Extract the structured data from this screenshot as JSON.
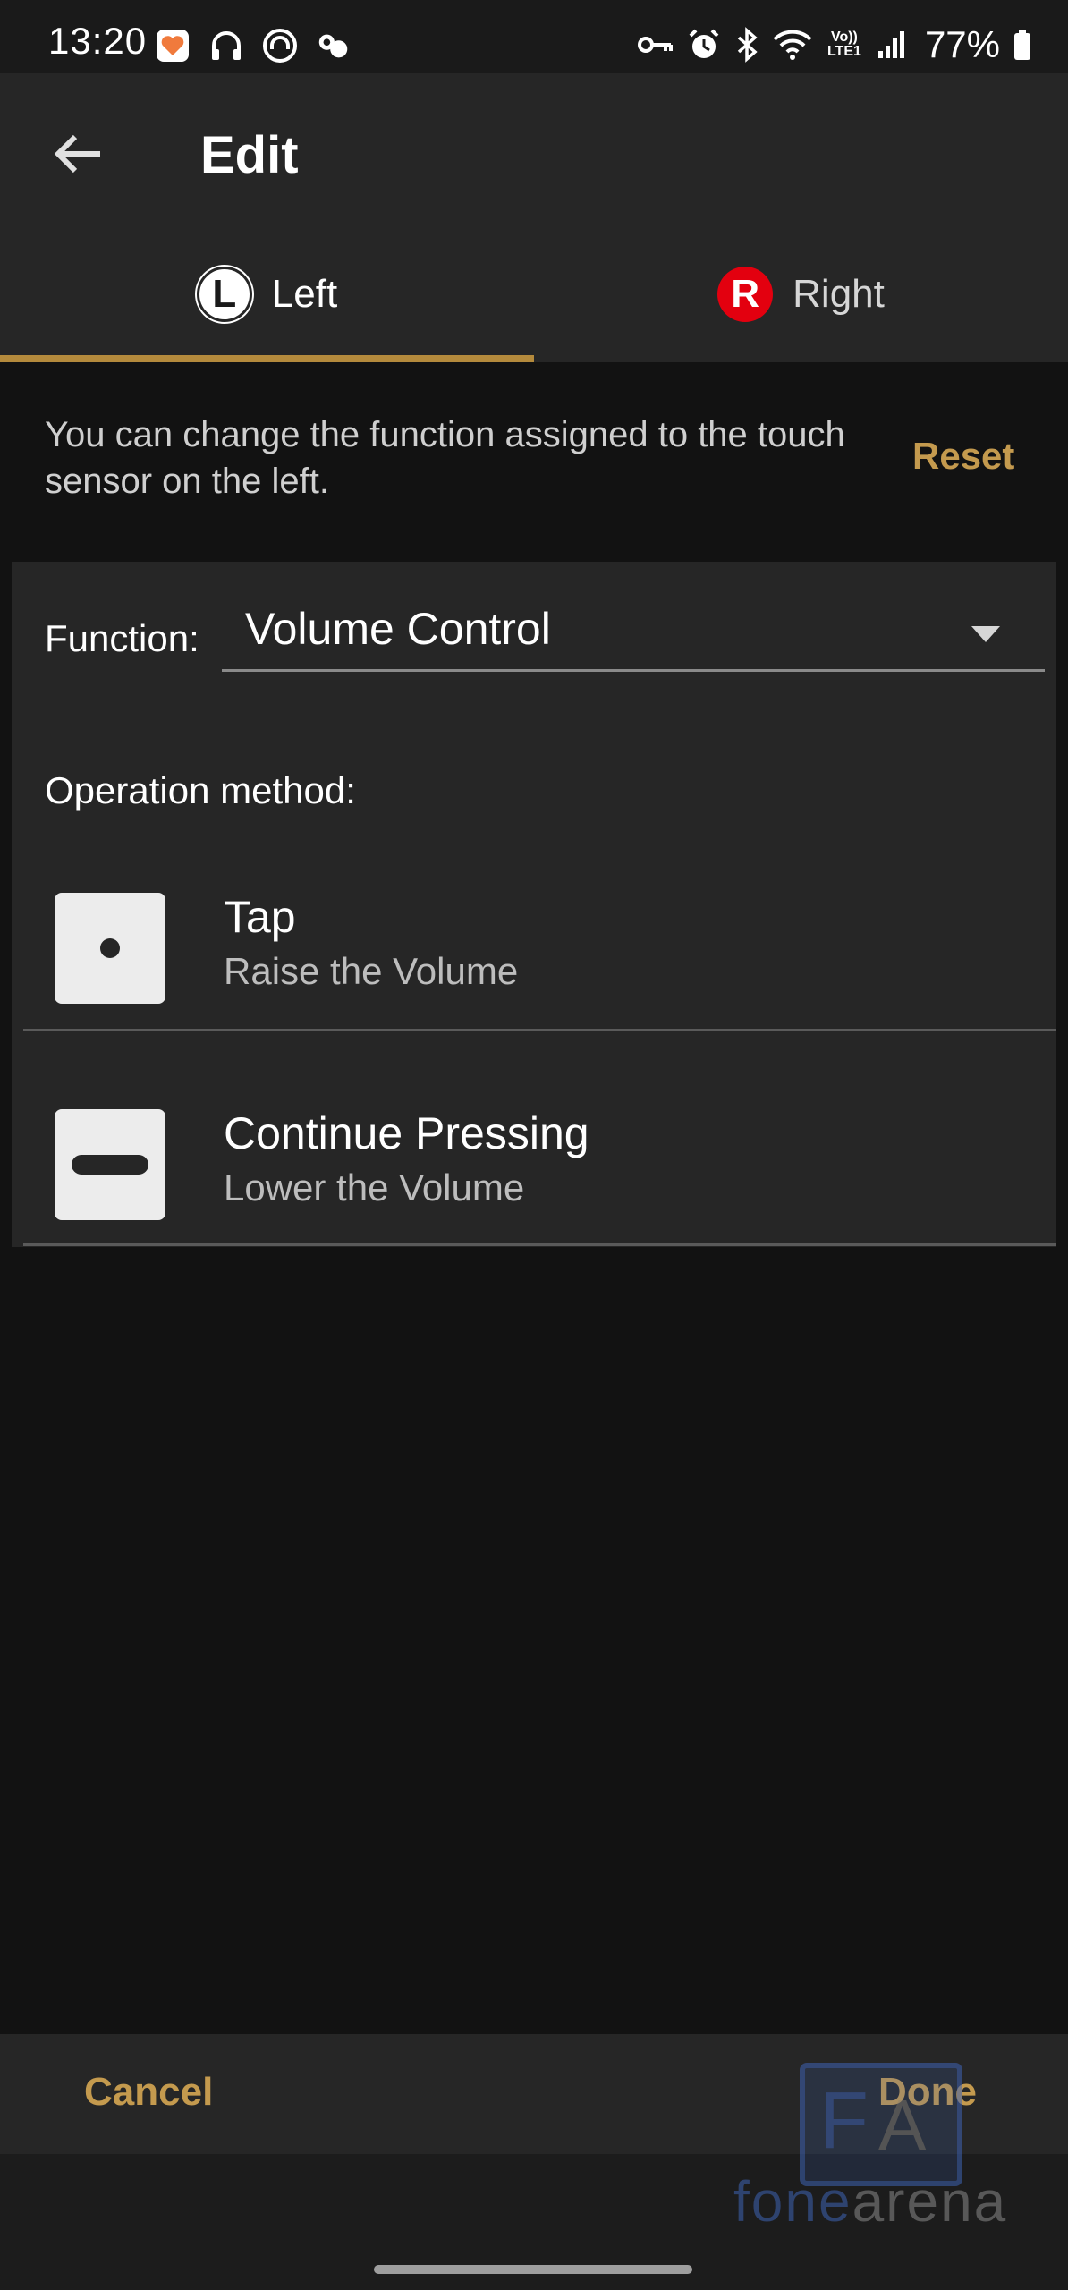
{
  "status_bar": {
    "time": "13:20",
    "notification_icons": [
      "health-app-icon",
      "headphones-icon",
      "sony-headphones-app-icon",
      "sound-connect-icon"
    ],
    "system_icons": [
      "vpn-key-icon",
      "alarm-icon",
      "bluetooth-icon",
      "wifi-icon",
      "volte-lte-icon",
      "signal-icon"
    ],
    "volte_label": "Vo)) LTE1",
    "battery_percent": "77%"
  },
  "app_bar": {
    "title": "Edit"
  },
  "tabs": [
    {
      "badge": "L",
      "label": "Left",
      "selected": true
    },
    {
      "badge": "R",
      "label": "Right",
      "selected": false
    }
  ],
  "description": "You can change the function assigned to the touch sensor on the left.",
  "reset_label": "Reset",
  "function": {
    "label": "Function:",
    "selected_value": "Volume Control"
  },
  "operation": {
    "label": "Operation method:",
    "rows": [
      {
        "icon": "tap-dot-icon",
        "title": "Tap",
        "subtitle": "Raise the Volume"
      },
      {
        "icon": "press-hold-bar-icon",
        "title": "Continue Pressing",
        "subtitle": "Lower the Volume"
      }
    ]
  },
  "bottom_bar": {
    "cancel_label": "Cancel",
    "done_label": "Done"
  },
  "watermark": {
    "logo_letters": "FA",
    "text_part1": "fone",
    "text_part2": "arena"
  },
  "colors": {
    "accent": "#b48a3c",
    "button_text": "#c49a4e",
    "right_badge": "#e3000f",
    "background": "#121212",
    "surface": "#262626"
  }
}
